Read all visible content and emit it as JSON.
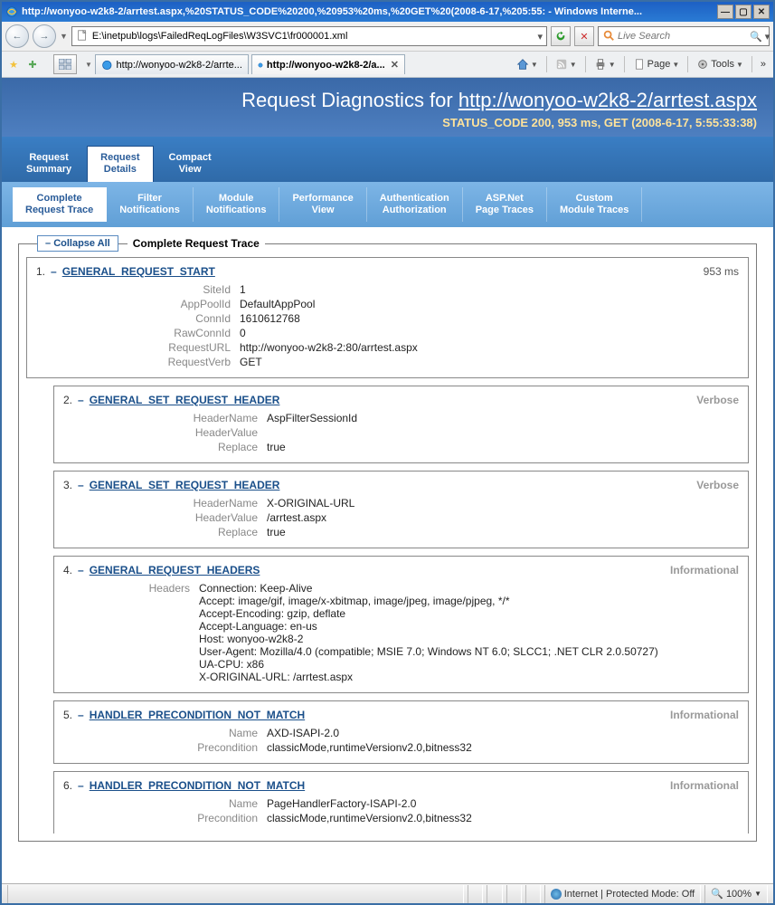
{
  "window": {
    "title": "http://wonyoo-w2k8-2/arrtest.aspx,%20STATUS_CODE%20200,%20953%20ms,%20GET%20(2008-6-17,%205:55: - Windows Interne...",
    "chevron": "»"
  },
  "toolbar": {
    "address": "E:\\inetpub\\logs\\FailedReqLogFiles\\W3SVC1\\fr000001.xml",
    "search_placeholder": "Live Search"
  },
  "tabs": {
    "t0": "http://wonyoo-w2k8-2/arrte...",
    "t1": "http://wonyoo-w2k8-2/a..."
  },
  "cmdbar": {
    "page": "Page",
    "tools": "Tools",
    "chevron": "»"
  },
  "header": {
    "title_prefix": "Request Diagnostics for ",
    "title_link": "http://wonyoo-w2k8-2/arrtest.aspx",
    "status": "STATUS_CODE 200, 953 ms, GET (2008-6-17, 5:55:33:38)"
  },
  "main_tabs": {
    "summary": "Request\nSummary",
    "details": "Request\nDetails",
    "compact": "Compact\nView"
  },
  "sub_tabs": {
    "complete": "Complete\nRequest Trace",
    "filter": "Filter\nNotifications",
    "module": "Module\nNotifications",
    "perf": "Performance\nView",
    "auth": "Authentication\nAuthorization",
    "asp": "ASP.Net\nPage Traces",
    "custom": "Custom\nModule Traces"
  },
  "legend": {
    "collapse": "Collapse All",
    "title": "Complete Request Trace"
  },
  "events": {
    "e1": {
      "num": "1.",
      "name": "GENERAL_REQUEST_START",
      "time": "953 ms",
      "rows": [
        {
          "k": "SiteId",
          "v": "1"
        },
        {
          "k": "AppPoolId",
          "v": "DefaultAppPool"
        },
        {
          "k": "ConnId",
          "v": "1610612768"
        },
        {
          "k": "RawConnId",
          "v": "0"
        },
        {
          "k": "RequestURL",
          "v": "http://wonyoo-w2k8-2:80/arrtest.aspx"
        },
        {
          "k": "RequestVerb",
          "v": "GET"
        }
      ]
    },
    "e2": {
      "num": "2.",
      "name": "GENERAL_SET_REQUEST_HEADER",
      "level": "Verbose",
      "rows": [
        {
          "k": "HeaderName",
          "v": "AspFilterSessionId"
        },
        {
          "k": "HeaderValue",
          "v": ""
        },
        {
          "k": "Replace",
          "v": "true"
        }
      ]
    },
    "e3": {
      "num": "3.",
      "name": "GENERAL_SET_REQUEST_HEADER",
      "level": "Verbose",
      "rows": [
        {
          "k": "HeaderName",
          "v": "X-ORIGINAL-URL"
        },
        {
          "k": "HeaderValue",
          "v": "/arrtest.aspx"
        },
        {
          "k": "Replace",
          "v": "true"
        }
      ]
    },
    "e4": {
      "num": "4.",
      "name": "GENERAL_REQUEST_HEADERS",
      "level": "Informational",
      "rows": [
        {
          "k": "Headers",
          "v": "Connection: Keep-Alive\nAccept: image/gif, image/x-xbitmap, image/jpeg, image/pjpeg, */*\nAccept-Encoding: gzip, deflate\nAccept-Language: en-us\nHost: wonyoo-w2k8-2\nUser-Agent: Mozilla/4.0 (compatible; MSIE 7.0; Windows NT 6.0; SLCC1; .NET CLR 2.0.50727)\nUA-CPU: x86\nX-ORIGINAL-URL: /arrtest.aspx"
        }
      ]
    },
    "e5": {
      "num": "5.",
      "name": "HANDLER_PRECONDITION_NOT_MATCH",
      "level": "Informational",
      "rows": [
        {
          "k": "Name",
          "v": "AXD-ISAPI-2.0"
        },
        {
          "k": "Precondition",
          "v": "classicMode,runtimeVersionv2.0,bitness32"
        }
      ]
    },
    "e6": {
      "num": "6.",
      "name": "HANDLER_PRECONDITION_NOT_MATCH",
      "level": "Informational",
      "rows": [
        {
          "k": "Name",
          "v": "PageHandlerFactory-ISAPI-2.0"
        },
        {
          "k": "Precondition",
          "v": "classicMode,runtimeVersionv2.0,bitness32"
        }
      ]
    }
  },
  "status": {
    "zone": "Internet | Protected Mode: Off",
    "zoom": "100%"
  }
}
